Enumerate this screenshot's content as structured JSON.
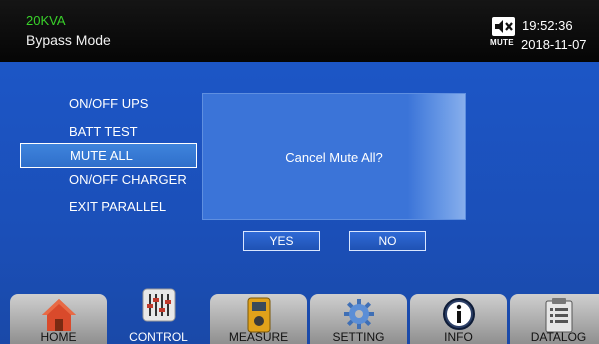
{
  "header": {
    "model": "20KVA",
    "mode": "Bypass Mode",
    "mute_caption": "MUTE",
    "time": "19:52:36",
    "date": "2018-11-07"
  },
  "menu": {
    "items": [
      {
        "label": "ON/OFF UPS"
      },
      {
        "label": "BATT TEST"
      },
      {
        "label": "MUTE ALL",
        "selected": true
      },
      {
        "label": "ON/OFF CHARGER"
      },
      {
        "label": "EXIT PARALLEL"
      }
    ]
  },
  "dialog": {
    "message": "Cancel Mute All?",
    "yes_label": "YES",
    "no_label": "NO"
  },
  "tabs": [
    {
      "label": "HOME",
      "icon": "home-icon"
    },
    {
      "label": "CONTROL",
      "icon": "control-sliders-icon",
      "active": true
    },
    {
      "label": "MEASURE",
      "icon": "multimeter-icon"
    },
    {
      "label": "SETTING",
      "icon": "gear-icon"
    },
    {
      "label": "INFO",
      "icon": "info-icon"
    },
    {
      "label": "DATALOG",
      "icon": "clipboard-icon"
    }
  ],
  "colors": {
    "background_blue": "#1c56c6",
    "model_green": "#39d12a",
    "dialog_blue": "#3b74d8"
  }
}
